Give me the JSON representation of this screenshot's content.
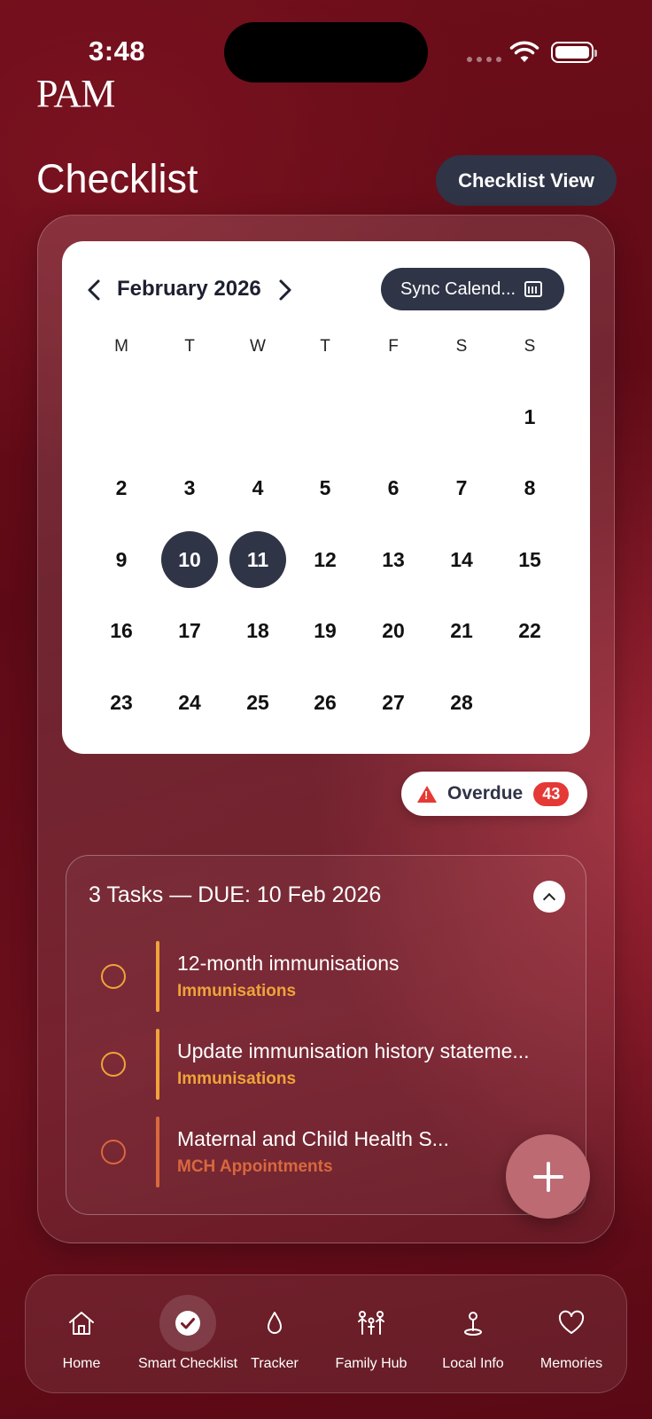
{
  "status_bar": {
    "time": "3:48"
  },
  "brand": {
    "logo_text": "PAM"
  },
  "header": {
    "title": "Checklist",
    "view_button_label": "Checklist View"
  },
  "calendar": {
    "month_label": "February 2026",
    "sync_button_label": "Sync Calend...",
    "weekdays": [
      "M",
      "T",
      "W",
      "T",
      "F",
      "S",
      "S"
    ],
    "days": {
      "d1": "1",
      "d2": "2",
      "d3": "3",
      "d4": "4",
      "d5": "5",
      "d6": "6",
      "d7": "7",
      "d8": "8",
      "d9": "9",
      "d10": "10",
      "d11": "11",
      "d12": "12",
      "d13": "13",
      "d14": "14",
      "d15": "15",
      "d16": "16",
      "d17": "17",
      "d18": "18",
      "d19": "19",
      "d20": "20",
      "d21": "21",
      "d22": "22",
      "d23": "23",
      "d24": "24",
      "d25": "25",
      "d26": "26",
      "d27": "27",
      "d28": "28"
    },
    "selected_days": [
      "10",
      "11"
    ]
  },
  "overdue": {
    "label": "Overdue",
    "count": "43"
  },
  "tasks": {
    "title": "3 Tasks — DUE: 10 Feb 2026",
    "items": [
      {
        "name": "12-month immunisations",
        "category": "Immunisations",
        "color": "#f0a33a"
      },
      {
        "name": "Update immunisation history stateme...",
        "category": "Immunisations",
        "color": "#f0a33a"
      },
      {
        "name": "Maternal and Child Health S...",
        "category": "MCH Appointments",
        "color": "#d9683e"
      }
    ]
  },
  "nav": {
    "items": [
      {
        "label": "Home",
        "icon": "home-icon"
      },
      {
        "label": "Smart Checklist",
        "icon": "check-circle-icon",
        "active": true
      },
      {
        "label": "Tracker",
        "icon": "drop-icon"
      },
      {
        "label": "Family Hub",
        "icon": "family-icon"
      },
      {
        "label": "Local Info",
        "icon": "location-pin-icon"
      },
      {
        "label": "Memories",
        "icon": "heart-icon"
      }
    ]
  },
  "colors": {
    "background": "#6a0f1c",
    "accent_dark": "#2f3447",
    "overdue_red": "#e53935",
    "fab": "#bd6a72"
  }
}
